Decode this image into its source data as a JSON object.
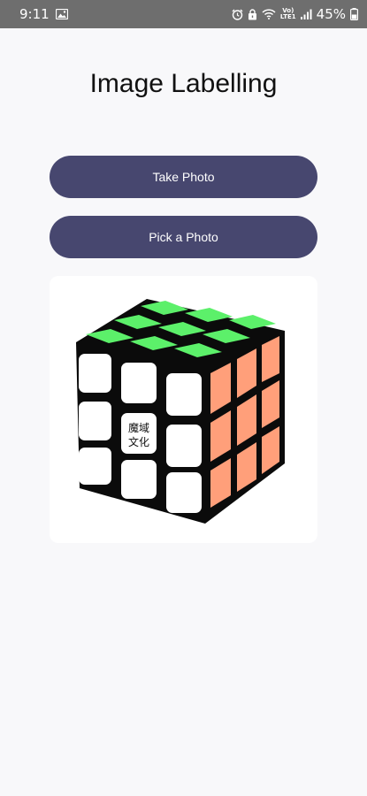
{
  "status_bar": {
    "time": "9:11",
    "battery": "45%",
    "network_label": "VoLTE1",
    "icons": [
      "gallery-icon",
      "alarm-icon",
      "lock-icon",
      "wifi-icon",
      "volte-icon",
      "signal-icon",
      "battery-icon"
    ]
  },
  "page": {
    "title": "Image Labelling"
  },
  "actions": {
    "take_photo": "Take Photo",
    "pick_photo": "Pick a Photo"
  },
  "preview": {
    "logo_text": "魔域文化",
    "colors": {
      "top": "#5cf06a",
      "front": "#ffffff",
      "side": "#ff9f7a",
      "body": "#0b0b0b"
    }
  },
  "theme": {
    "button_bg": "#47476f",
    "status_bg": "#6e6e6e",
    "page_bg": "#f8f8fa"
  }
}
